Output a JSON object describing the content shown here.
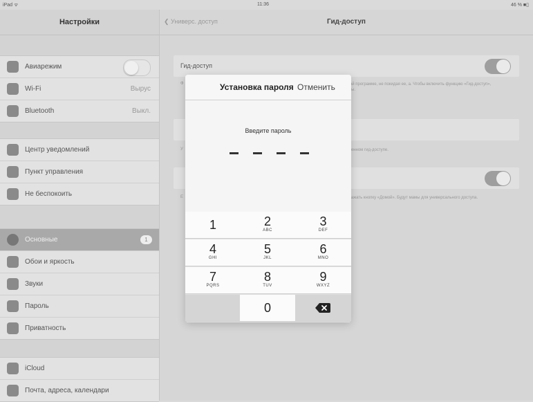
{
  "status_bar": {
    "left": "iPad ᯤ",
    "center": "11:36",
    "right": "46 % ■▯"
  },
  "sidebar": {
    "title": "Настройки",
    "group1": [
      {
        "label": "Авиарежим",
        "icon": "airplane-icon",
        "value": "",
        "control": "toggle-off"
      },
      {
        "label": "Wi-Fi",
        "icon": "wifi-icon",
        "value": "Вырус"
      },
      {
        "label": "Bluetooth",
        "icon": "bluetooth-icon",
        "value": "Выкл."
      }
    ],
    "group2": [
      {
        "label": "Центр уведомлений",
        "icon": "notifications-icon"
      },
      {
        "label": "Пункт управления",
        "icon": "control-center-icon"
      },
      {
        "label": "Не беспокоить",
        "icon": "moon-icon"
      }
    ],
    "group3": [
      {
        "label": "Основные",
        "icon": "gear-icon",
        "badge": "1",
        "active": true
      },
      {
        "label": "Обои и яркость",
        "icon": "wallpaper-icon"
      },
      {
        "label": "Звуки",
        "icon": "sound-icon"
      },
      {
        "label": "Пароль",
        "icon": "lock-icon"
      },
      {
        "label": "Приватность",
        "icon": "hand-icon"
      }
    ],
    "group4": [
      {
        "label": "iCloud",
        "icon": "cloud-icon"
      },
      {
        "label": "Почта, адреса, календари",
        "icon": "mail-icon"
      }
    ]
  },
  "main": {
    "back_label": "Универс. доступ",
    "title": "Гид-доступ",
    "row1_label": "Гид-доступ",
    "desc1": "в одной программе, не покидая ее, а. Чтобы включить функцию «Гид-доступ», граммы.",
    "desc1_left": "Ф",
    "desc2": "включенном гид-доступе.",
    "desc2_left": "У",
    "desc3": "жды нажать кнопку «Домой». Будут мамы для универсального доступа.",
    "desc3_left": "E"
  },
  "modal": {
    "title": "Установка пароля",
    "cancel": "Отменить",
    "prompt": "Введите пароль",
    "keys": [
      {
        "num": "1",
        "letters": ""
      },
      {
        "num": "2",
        "letters": "ABC"
      },
      {
        "num": "3",
        "letters": "DEF"
      },
      {
        "num": "4",
        "letters": "GHI"
      },
      {
        "num": "5",
        "letters": "JKL"
      },
      {
        "num": "6",
        "letters": "MNO"
      },
      {
        "num": "7",
        "letters": "PQRS"
      },
      {
        "num": "8",
        "letters": "TUV"
      },
      {
        "num": "9",
        "letters": "WXYZ"
      },
      {
        "num": "0",
        "letters": ""
      }
    ],
    "delete_icon": "backspace-icon"
  },
  "colors": {
    "dim_background": "#d6d6d6",
    "modal_bg": "#f5f5f5",
    "key_bg": "#fbfbfb"
  }
}
